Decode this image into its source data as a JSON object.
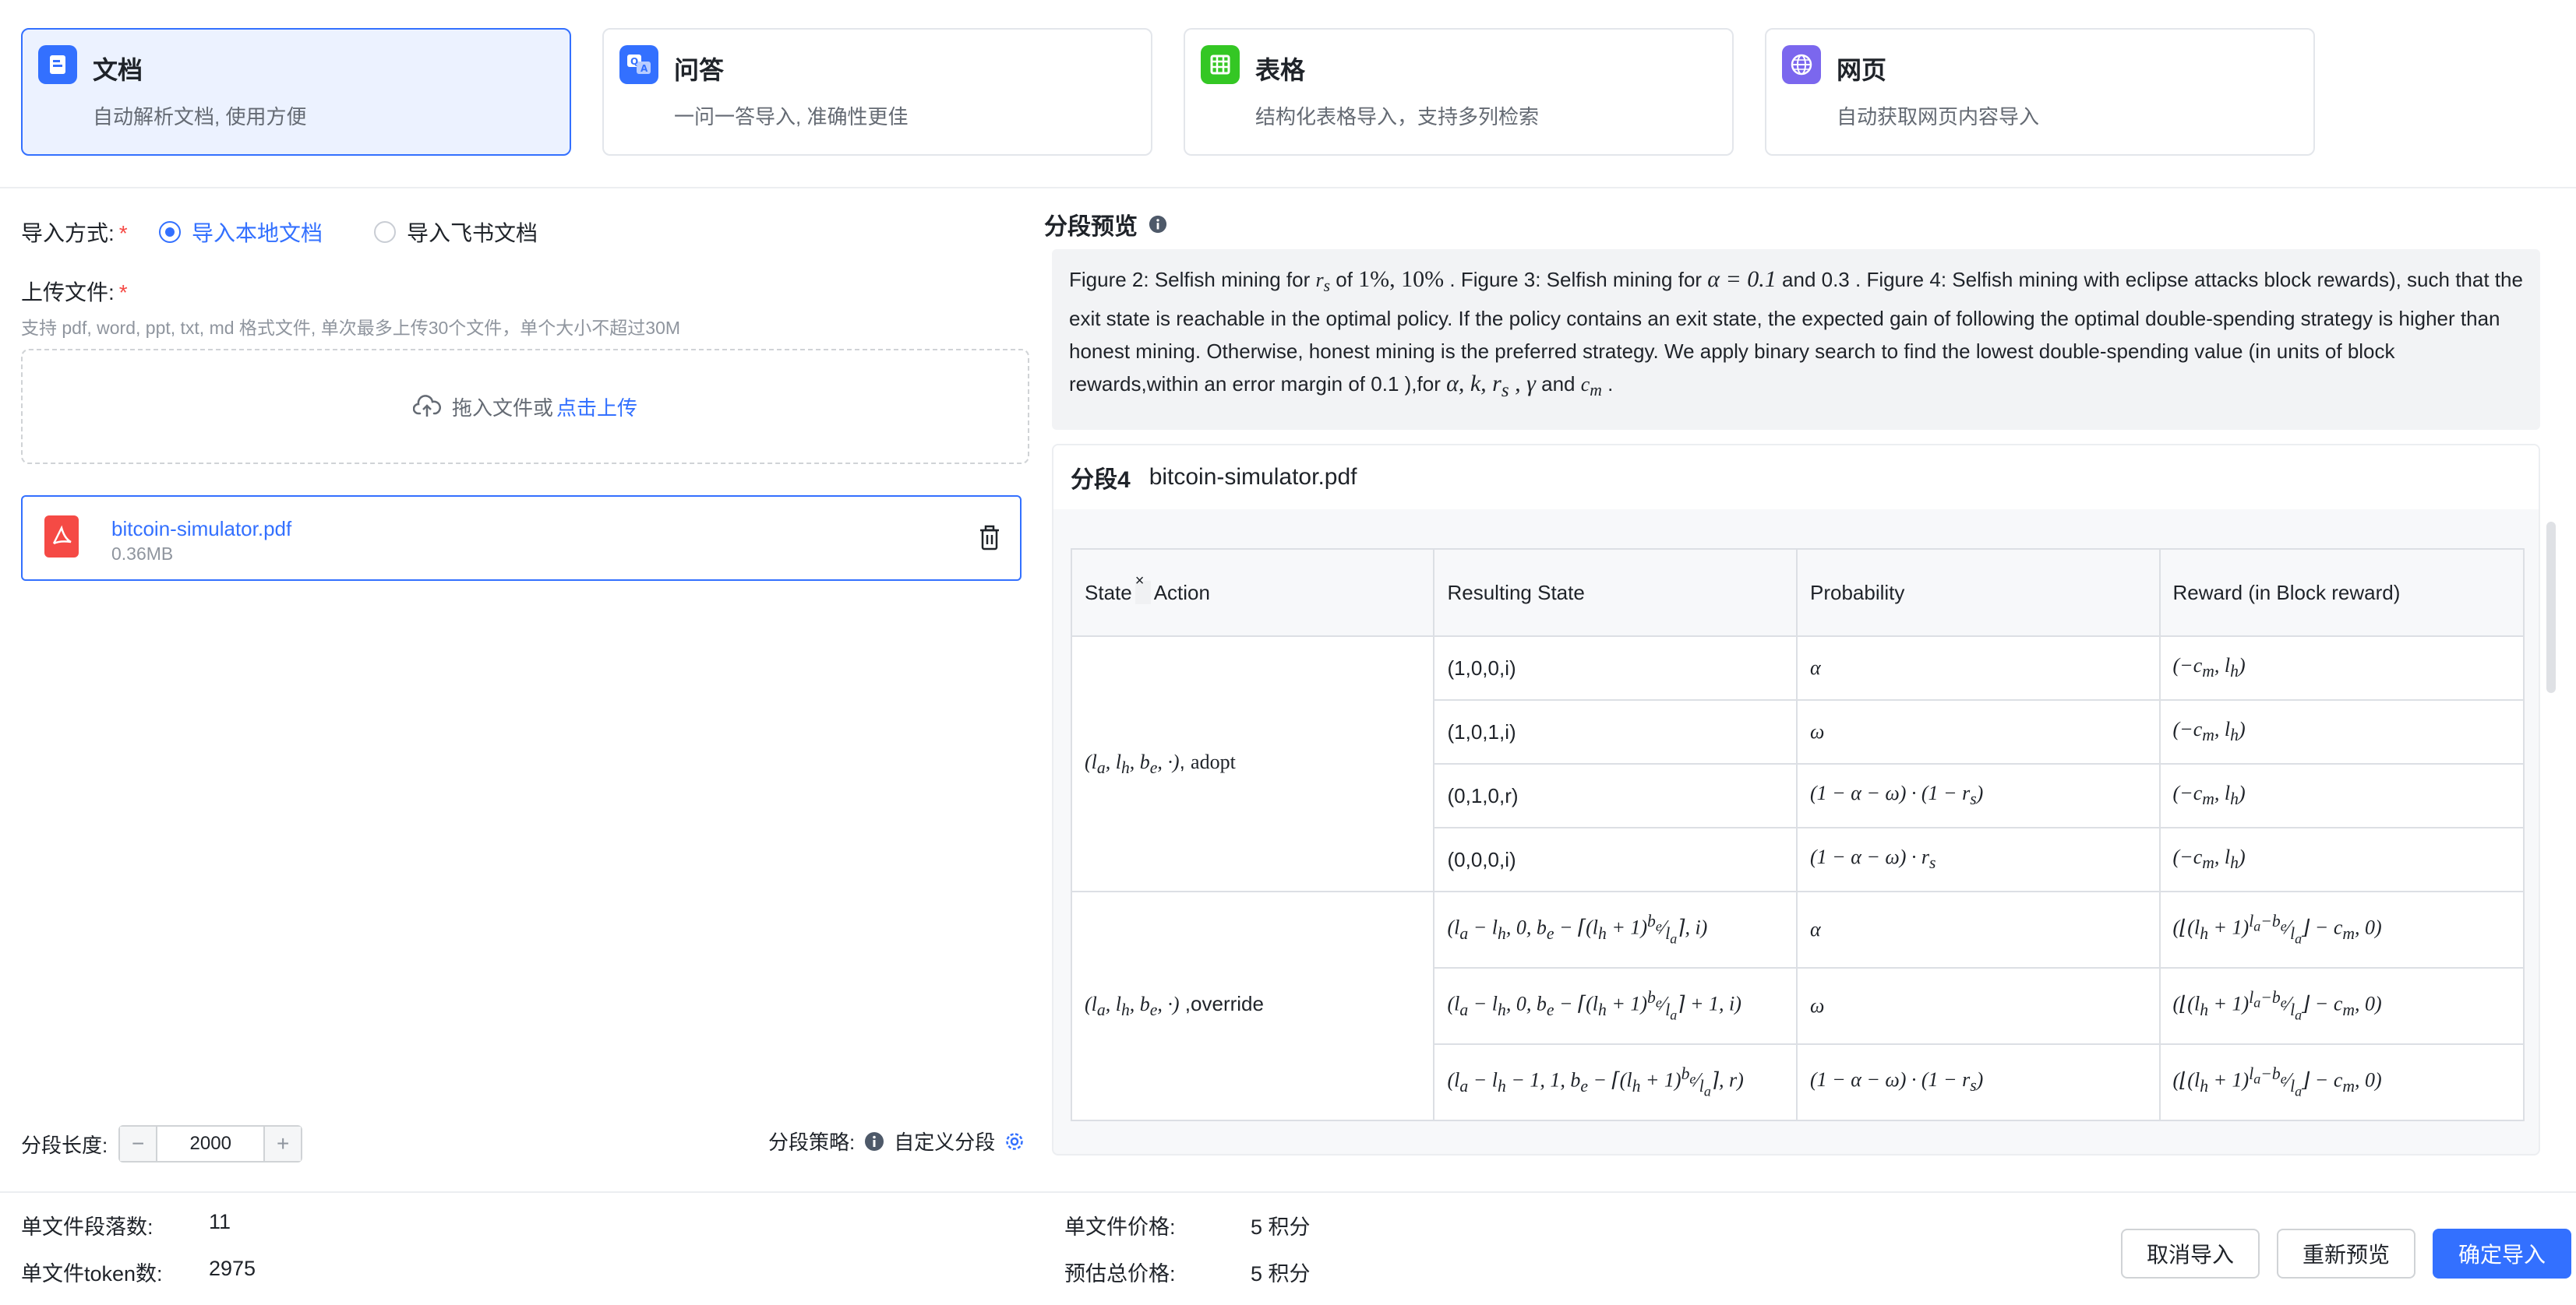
{
  "cards": [
    {
      "title": "文档",
      "desc": "自动解析文档, 使用方便",
      "color": "#3370ff",
      "icon": "document-icon"
    },
    {
      "title": "问答",
      "desc": "一问一答导入, 准确性更佳",
      "color": "#3370ff",
      "icon": "qa-icon"
    },
    {
      "title": "表格",
      "desc": "结构化表格导入，支持多列检索",
      "color": "#34c724",
      "icon": "table-icon"
    },
    {
      "title": "网页",
      "desc": "自动获取网页内容导入",
      "color": "#7b67ee",
      "icon": "globe-icon"
    }
  ],
  "form": {
    "import_method_label": "导入方式:",
    "option_local": "导入本地文档",
    "option_feishu": "导入飞书文档",
    "upload_label": "上传文件:",
    "upload_hint": "支持 pdf, word, ppt, txt, md 格式文件, 单次最多上传30个文件，单个大小不超过30M",
    "drop_text": "拖入文件或",
    "drop_link": "点击上传",
    "file_name": "bitcoin-simulator.pdf",
    "file_size": "0.36MB",
    "seg_length_label": "分段长度:",
    "seg_length_value": "2000",
    "seg_strategy_label": "分段策略:",
    "seg_strategy_value": "自定义分段"
  },
  "preview": {
    "title": "分段预览",
    "text_p1": "Figure 2: Selfish mining for ",
    "text_rs": "r",
    "text_rs_sub": "s",
    "text_of": " of ",
    "text_pcts": "1%, 10%",
    "text_p2": " . Figure 3: Selfish mining for ",
    "text_alpha": "α = 0.1",
    "text_p3": " and 0.3 . Figure 4: Selfish mining with eclipse attacks block rewards), such that the exit state is reachable in the optimal policy. If the policy contains an exit state, the expected gain of following the optimal double-spending strategy is higher than honest mining. Otherwise, honest mining is the preferred strategy. We apply binary search to find the lowest double-spending value (in units of block rewards,within an error margin of 0.1 ),for ",
    "text_params": "α, k, r",
    "text_params_sub": "s",
    "text_gamma": " , γ",
    "text_and": " and ",
    "text_cm": "c",
    "text_cm_sub": "m",
    "text_end": " .",
    "segment_label": "分段4",
    "segment_file": "bitcoin-simulator.pdf",
    "table": {
      "headers": [
        "State",
        "Action",
        "Resulting State",
        "Probability",
        "Reward (in Block reward)"
      ],
      "group1_state": "(l",
      "group1_action": "adopt",
      "group2_action": "override",
      "rows": [
        {
          "result": "(1,0,0,i)",
          "prob": "α",
          "reward": "(−c"
        },
        {
          "result": "(1,0,1,i)",
          "prob": "ω",
          "reward": "(−c"
        },
        {
          "result": "(0,1,0,r)",
          "prob": "(1 − α − ω) · (1 − r",
          "reward": "(−c"
        },
        {
          "result": "(0,0,0,i)",
          "prob": "(1 − α − ω) · r",
          "reward": "(−c"
        }
      ],
      "rows2": [
        {
          "prob": "α"
        },
        {
          "prob": "ω"
        },
        {
          "prob": "(1 − α − ω) · (1 − r"
        }
      ]
    }
  },
  "footer": {
    "seg_count_label": "单文件段落数:",
    "seg_count_value": "11",
    "token_label": "单文件token数:",
    "token_value": "2975",
    "price_label": "单文件价格:",
    "price_value": "5 积分",
    "total_label": "预估总价格:",
    "total_value": "5 积分",
    "cancel": "取消导入",
    "repreview": "重新预览",
    "confirm": "确定导入"
  }
}
